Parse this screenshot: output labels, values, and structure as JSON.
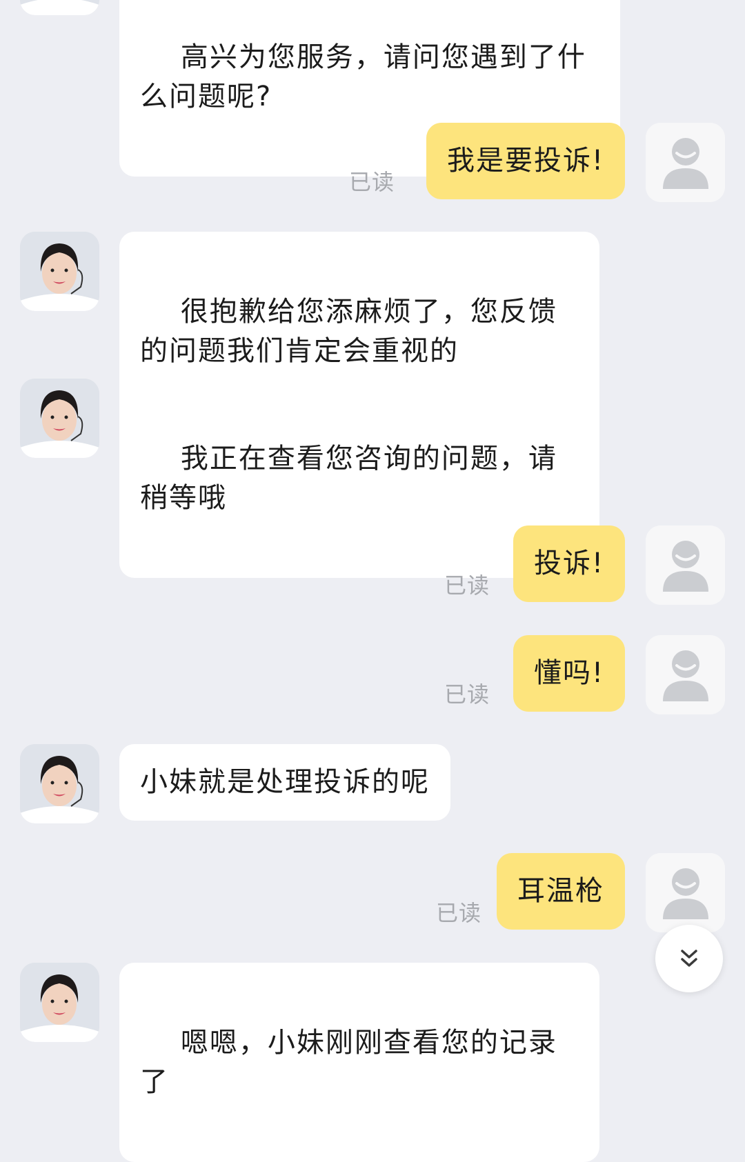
{
  "messages": [
    {
      "sender": "agent",
      "text": "高兴为您服务，请问您遇到了什么问题呢?"
    },
    {
      "sender": "user",
      "text": "我是要投诉!",
      "status": "已读"
    },
    {
      "sender": "agent",
      "text": "很抱歉给您添麻烦了，您反馈的问题我们肯定会重视的"
    },
    {
      "sender": "agent",
      "text": "我正在查看您咨询的问题，请稍等哦"
    },
    {
      "sender": "user",
      "text": "投诉!",
      "status": "已读"
    },
    {
      "sender": "user",
      "text": "懂吗!",
      "status": "已读"
    },
    {
      "sender": "agent",
      "text": "小妹就是处理投诉的呢"
    },
    {
      "sender": "user",
      "text": "耳温枪",
      "status": "已读"
    },
    {
      "sender": "agent",
      "text": "嗯嗯，小妹刚刚查看您的记录了"
    }
  ],
  "icons": {
    "agent_avatar": "agent-avatar-icon",
    "user_avatar": "user-avatar-icon",
    "scroll_down": "double-chevron-down-icon"
  },
  "colors": {
    "background": "#edeef3",
    "agent_bubble": "#ffffff",
    "user_bubble": "#fde47d",
    "read_status": "#a7a9ae"
  }
}
